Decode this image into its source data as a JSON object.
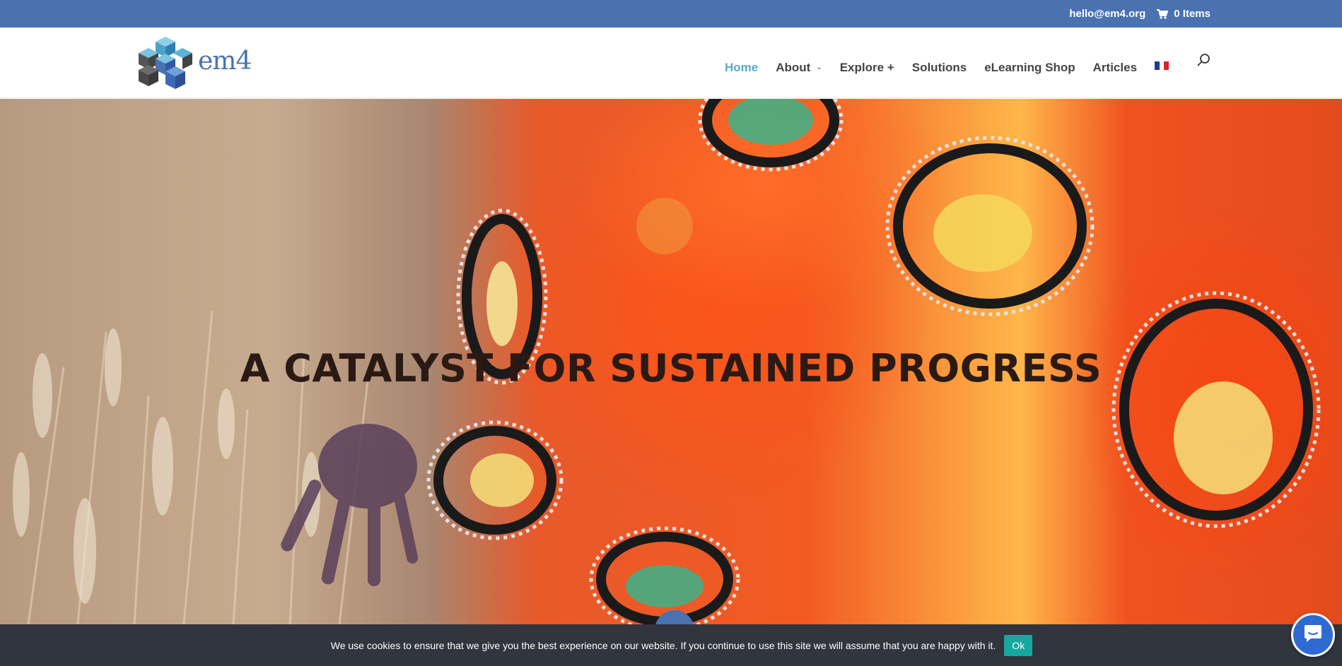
{
  "topbar": {
    "email": "hello@em4.org",
    "cart_label": "0 Items",
    "cart_icon": "shopping-cart-icon",
    "background": "#4a72b0"
  },
  "header": {
    "logo_text": "em4",
    "logo_icon": "cube-cluster-icon",
    "nav": [
      {
        "label": "Home",
        "active": true
      },
      {
        "label": "About",
        "dropdown": true
      },
      {
        "label": "Explore +"
      },
      {
        "label": "Solutions"
      },
      {
        "label": "eLearning Shop"
      },
      {
        "label": "Articles"
      }
    ],
    "language_icon": "french-flag-icon",
    "search_icon": "search-icon",
    "active_color": "#5aa9c9"
  },
  "hero": {
    "title": "A CATALYST FOR SUSTAINED PROGRESS",
    "scroll_icon": "arrow-down-icon"
  },
  "cookie_bar": {
    "message": "We use cookies to ensure that we give you the best experience on our website. If you continue to use this site we will assume that you are happy with it.",
    "ok_label": "Ok",
    "button_color": "#14a8a0"
  },
  "chat_widget": {
    "icon": "chat-bubble-icon",
    "color": "#2f6ad3"
  }
}
